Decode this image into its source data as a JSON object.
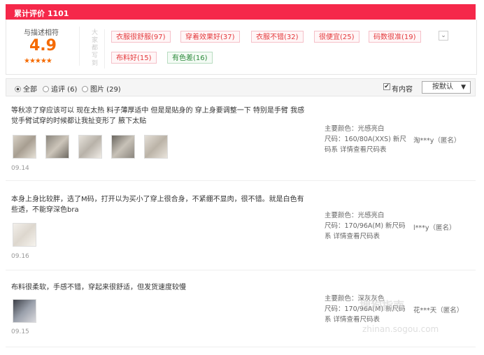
{
  "header": {
    "title": "累计评价 1101"
  },
  "summary": {
    "desc_label": "与描述相符",
    "score": "4.9",
    "stars": "★★★★★",
    "vertical_label": "大家都写到",
    "tags": [
      {
        "label": "衣服很舒服(97)",
        "type": "good"
      },
      {
        "label": "穿着效果好(37)",
        "type": "good"
      },
      {
        "label": "衣服不错(32)",
        "type": "good"
      },
      {
        "label": "很便宜(25)",
        "type": "good"
      },
      {
        "label": "码数很准(19)",
        "type": "good"
      },
      {
        "label": "布料好(15)",
        "type": "good"
      },
      {
        "label": "有色差(16)",
        "type": "bad"
      }
    ],
    "expand_icon": "chevron-down-icon"
  },
  "filters": {
    "all": "全部",
    "append": "追评 (6)",
    "pics": "图片 (29)",
    "has_content": "有内容",
    "sort_label": "按默认"
  },
  "reviews": [
    {
      "content": "等秋凉了穿应该可以 现在太热 料子薄厚适中 但是是贴身的 穿上身要调整一下 特别是手臂 我感觉手臂试穿的时候都让我扯变形了 腋下太贴",
      "date": "09.14",
      "color_line": "主要颜色：光感亮白",
      "size_line": "尺码：160/80A(XXS) 新尺码系 详情查看尺码表",
      "user": "淘***y（匿名）"
    },
    {
      "content": "本身上身比较胖，选了M码，打开以为买小了穿上很合身，不紧绷不显肉，很不错。就是白色有些透，不能穿深色bra",
      "date": "09.16",
      "color_line": "主要颜色：光感亮白",
      "size_line": "尺码：170/96A(M) 新尺码系 详情查看尺码表",
      "user": "l***y（匿名）"
    },
    {
      "content": "布料很柔软，手感不错，穿起来很舒适，但发货速度较慢",
      "date": "09.15",
      "color_line": "主要颜色：深灰灰色",
      "size_line": "尺码：170/96A(M) 新尺码系 详情查看尺码表",
      "user": "花***天（匿名）"
    }
  ],
  "watermark": {
    "line1": "搜狗指南",
    "line2": "zhinan.sogou.com"
  }
}
